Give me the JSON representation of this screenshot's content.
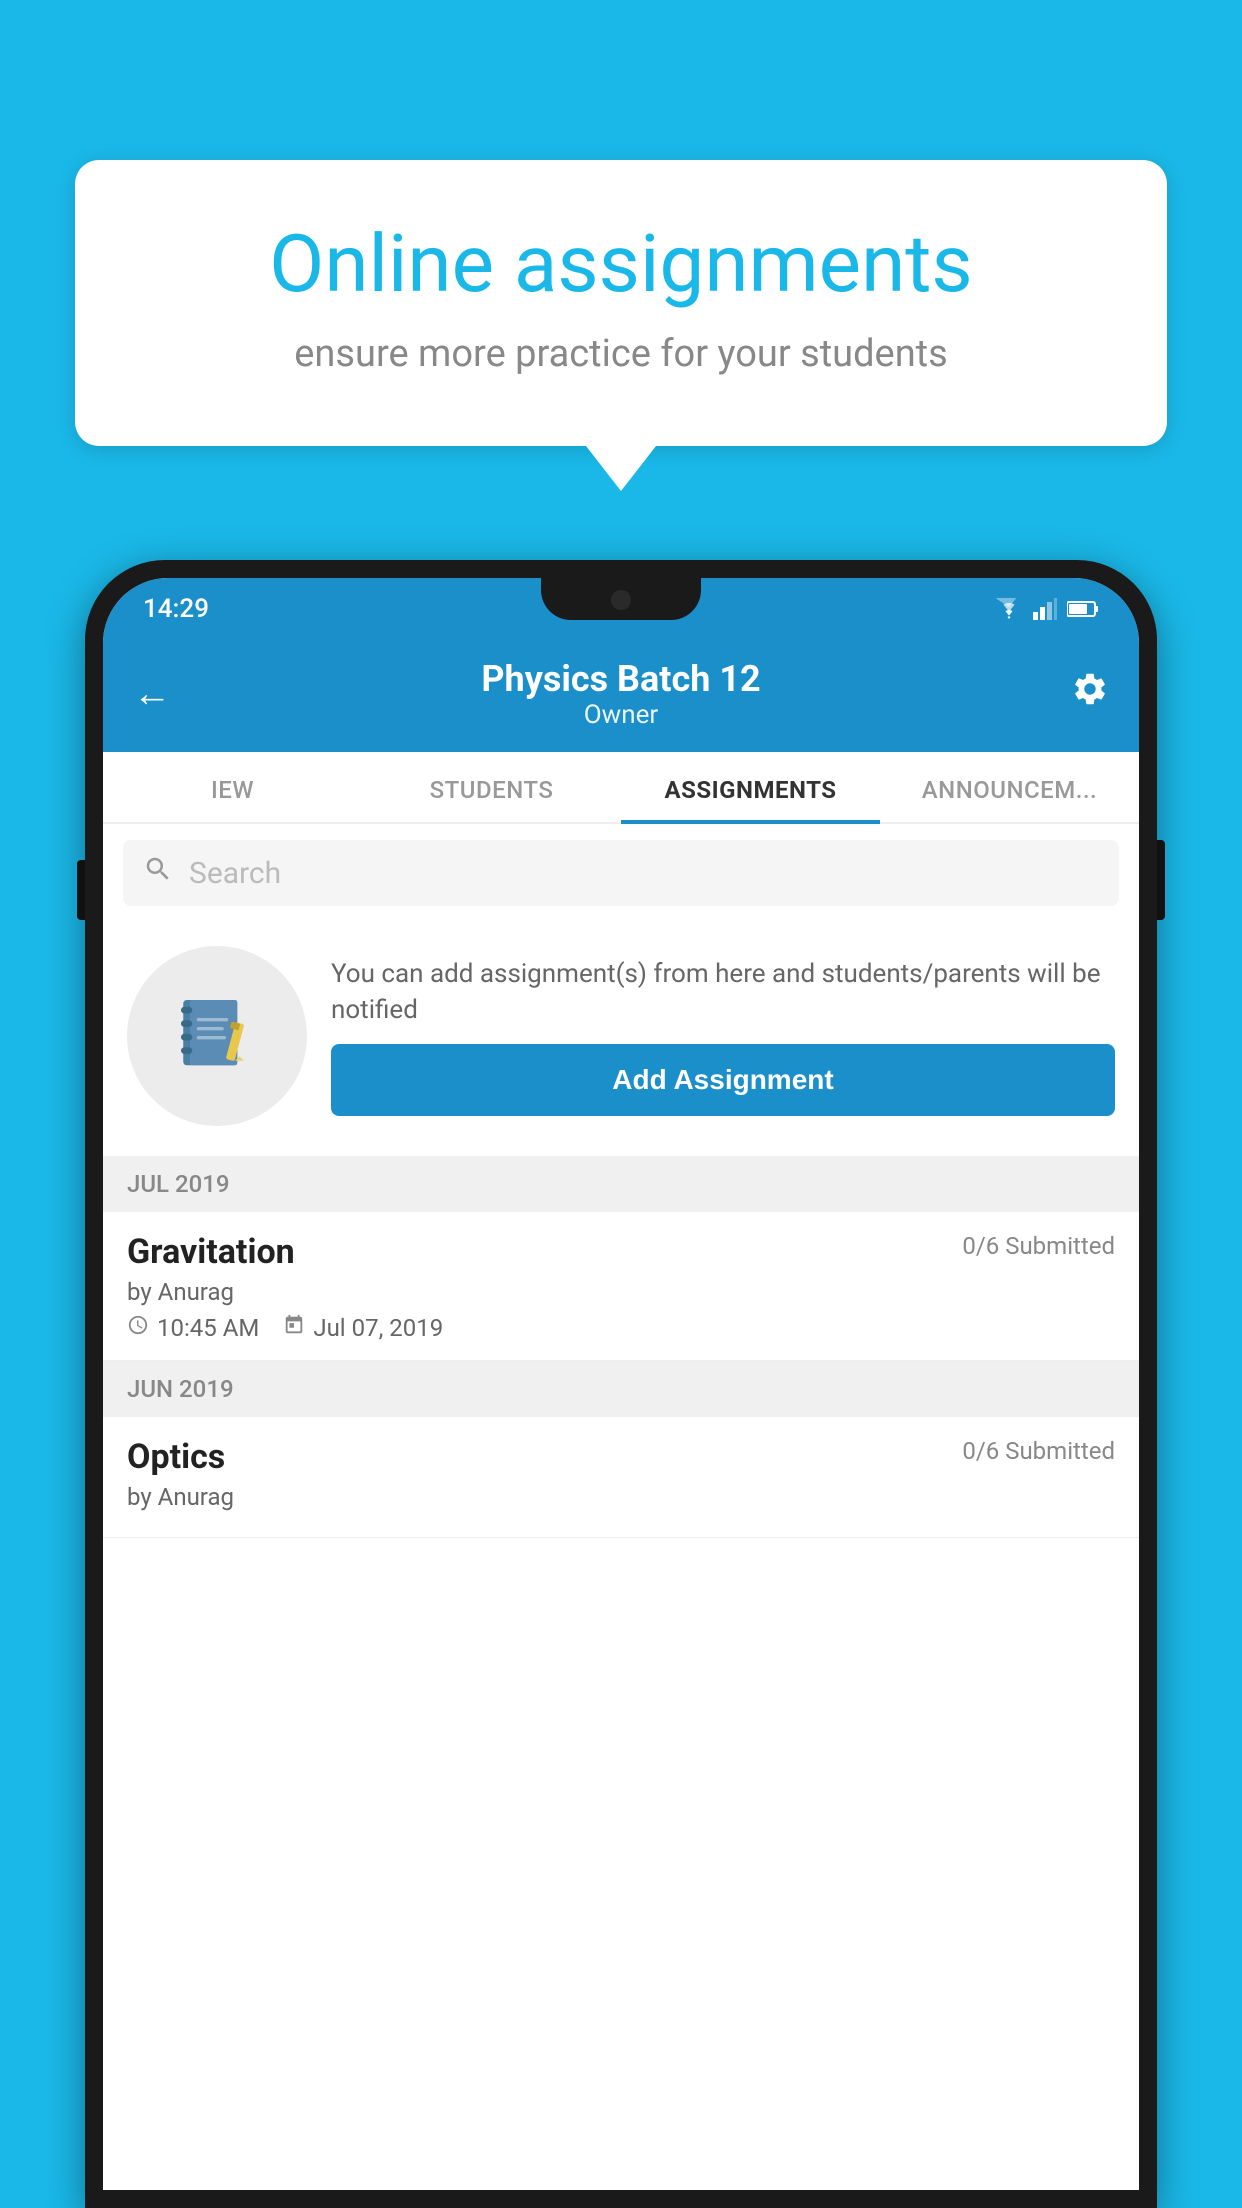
{
  "background": {
    "color": "#1ab8e8"
  },
  "speech_bubble": {
    "title": "Online assignments",
    "subtitle": "ensure more practice for your students"
  },
  "status_bar": {
    "time": "14:29"
  },
  "header": {
    "title": "Physics Batch 12",
    "subtitle": "Owner"
  },
  "tabs": [
    {
      "label": "IEW",
      "active": false
    },
    {
      "label": "STUDENTS",
      "active": false
    },
    {
      "label": "ASSIGNMENTS",
      "active": true
    },
    {
      "label": "ANNOUNCEM...",
      "active": false
    }
  ],
  "search": {
    "placeholder": "Search"
  },
  "promo": {
    "text": "You can add assignment(s) from here and students/parents will be notified",
    "button_label": "Add Assignment"
  },
  "sections": [
    {
      "header": "JUL 2019",
      "assignments": [
        {
          "name": "Gravitation",
          "status": "0/6 Submitted",
          "author": "by Anurag",
          "time": "10:45 AM",
          "date": "Jul 07, 2019"
        }
      ]
    },
    {
      "header": "JUN 2019",
      "assignments": [
        {
          "name": "Optics",
          "status": "0/6 Submitted",
          "author": "by Anurag",
          "time": "",
          "date": ""
        }
      ]
    }
  ]
}
